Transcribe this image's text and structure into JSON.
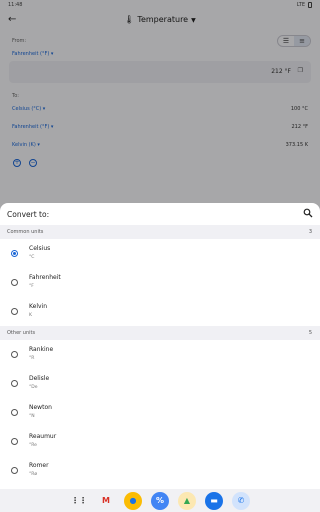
{
  "status_bar": {
    "time": "11:48",
    "network": "LTE"
  },
  "app_bar": {
    "title": "Temperature"
  },
  "from": {
    "label": "From:",
    "unit": "Fahrenheit (°F)",
    "value": "212 °F"
  },
  "to": {
    "label": "To:",
    "results": [
      {
        "unit": "Celsius (°C)",
        "value": "100 °C"
      },
      {
        "unit": "Fahrenheit (°F)",
        "value": "212 °F"
      },
      {
        "unit": "Kelvin (K)",
        "value": "373.15 K"
      }
    ]
  },
  "sheet": {
    "title": "Convert to:",
    "common": {
      "label": "Common units",
      "count": "3",
      "items": [
        {
          "name": "Celsius",
          "symbol": "°C",
          "selected": true
        },
        {
          "name": "Fahrenheit",
          "symbol": "°F",
          "selected": false
        },
        {
          "name": "Kelvin",
          "symbol": "K",
          "selected": false
        }
      ]
    },
    "other": {
      "label": "Other units",
      "count": "5",
      "items": [
        {
          "name": "Rankine",
          "symbol": "°R"
        },
        {
          "name": "Delisle",
          "symbol": "°De"
        },
        {
          "name": "Newton",
          "symbol": "°N"
        },
        {
          "name": "Reaumur",
          "symbol": "°Re"
        },
        {
          "name": "Romer",
          "symbol": "°Rø"
        }
      ]
    }
  },
  "navbar_apps": [
    {
      "name": "app-drawer-icon",
      "glyph": "⋮⋮",
      "color": "#333333",
      "bg": "transparent"
    },
    {
      "name": "gmail-icon",
      "glyph": "M",
      "color": "#d93025",
      "bg": "transparent"
    },
    {
      "name": "chrome-icon",
      "glyph": "●",
      "color": "#1a73e8",
      "bg": "#fbbc04"
    },
    {
      "name": "calculator-icon",
      "glyph": "%",
      "color": "#ffffff",
      "bg": "#4285f4"
    },
    {
      "name": "drive-icon",
      "glyph": "▲",
      "color": "#34a853",
      "bg": "#fce8b2"
    },
    {
      "name": "messages-icon",
      "glyph": "▬",
      "color": "#ffffff",
      "bg": "#1a73e8"
    },
    {
      "name": "phone-icon",
      "glyph": "✆",
      "color": "#1a73e8",
      "bg": "#d2e3fc"
    }
  ]
}
